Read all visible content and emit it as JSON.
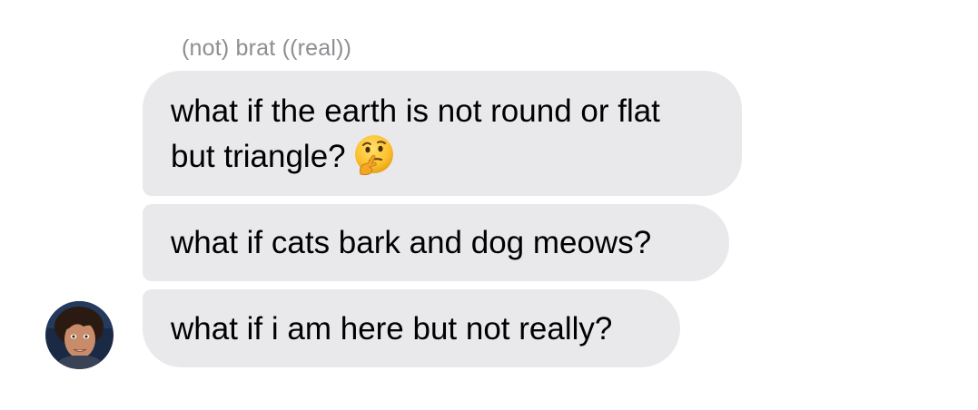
{
  "conversation": {
    "sender_name": "(not) brat ((real))",
    "messages": [
      {
        "lines": [
          "what if the earth is not round or flat",
          "but triangle?"
        ],
        "emoji": "thinking-face"
      },
      {
        "lines": [
          "what if cats bark and dog meows?"
        ]
      },
      {
        "lines": [
          "what if i am here but not really?"
        ]
      }
    ],
    "avatar": "profile-photo"
  },
  "colors": {
    "bubble": "#e9e9eb",
    "text": "#000000",
    "sender_name": "#8e8e93",
    "background": "#ffffff"
  }
}
